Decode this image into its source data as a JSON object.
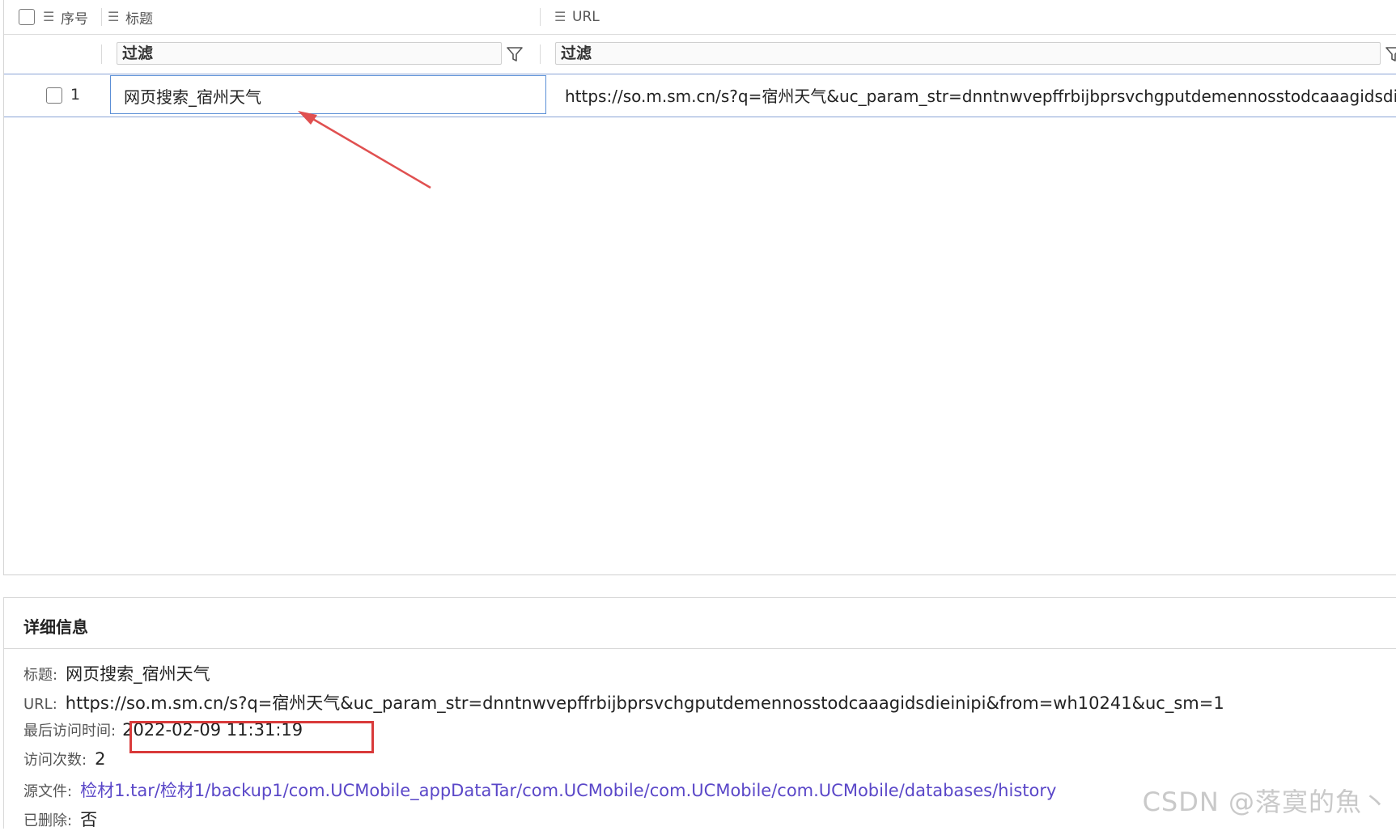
{
  "grid": {
    "columns": [
      {
        "key": "index",
        "label": "序号"
      },
      {
        "key": "title",
        "label": "标题"
      },
      {
        "key": "url",
        "label": "URL"
      }
    ],
    "filter_placeholder": "过滤",
    "rows": [
      {
        "index": "1",
        "title": "网页搜索_宿州天气",
        "url": "https://so.m.sm.cn/s?q=宿州天气&uc_param_str=dnntnwvepffrbijbprsvchgputdemennosstodcaaagidsdieinipi&f"
      }
    ]
  },
  "detail": {
    "heading": "详细信息",
    "fields": [
      {
        "label": "标题:",
        "value": "网页搜索_宿州天气"
      },
      {
        "label": "URL:",
        "value": "https://so.m.sm.cn/s?q=宿州天气&uc_param_str=dnntnwvepffrbijbprsvchgputdemennosstodcaaagidsdieinipi&from=wh10241&uc_sm=1"
      },
      {
        "label": "最后访问时间:",
        "value": "2022-02-09 11:31:19"
      },
      {
        "label": "访问次数:",
        "value": "2"
      },
      {
        "label": "源文件:",
        "value": "检材1.tar/检材1/backup1/com.UCMobile_appDataTar/com.UCMobile/com.UCMobile/com.UCMobile/databases/history"
      },
      {
        "label": "已删除:",
        "value": "否"
      }
    ]
  },
  "annotation": {
    "arrow_color": "#e05050",
    "highlight_color": "#d93a3a"
  },
  "watermark": "CSDN @落寞的魚丶"
}
